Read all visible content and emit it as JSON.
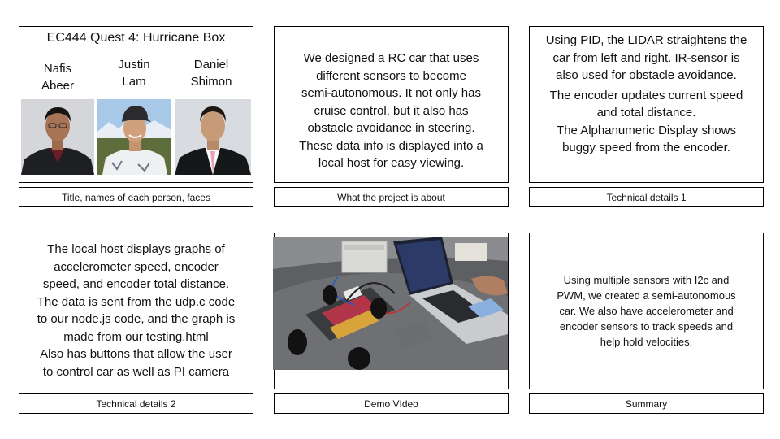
{
  "slide": {
    "title_panel": {
      "title": "EC444 Quest 4: Hurricane Box",
      "people": [
        {
          "first": "Nafis",
          "last": "Abeer"
        },
        {
          "first": "Justin",
          "last": "Lam"
        },
        {
          "first": "Daniel",
          "last": "Shimon"
        }
      ],
      "label": "Title, names of each person, faces"
    },
    "about_panel": {
      "lines": [
        "We designed  a RC car that uses",
        "different sensors to become",
        "semi-autonomous. It not only has",
        "cruise control, but it also has",
        "obstacle avoidance in steering.",
        "These data info is displayed into a",
        "local host for easy viewing."
      ],
      "label": "What the project is about"
    },
    "tech1_panel": {
      "lines": [
        "Using PID, the LIDAR straightens the",
        "car from left and right.  IR-sensor is",
        "also used for obstacle avoidance.",
        "The encoder updates current speed",
        "and total distance.",
        "The Alphanumeric  Display shows",
        "buggy speed from the encoder."
      ],
      "label": "Technical details 1"
    },
    "tech2_panel": {
      "lines": [
        "The local host displays graphs of",
        "accelerometer speed, encoder",
        "speed, and encoder total distance.",
        "The data is sent from the udp.c code",
        "to our node.js code, and the graph is",
        "made from our testing.html",
        "Also has buttons that allow the user",
        "to control car as well as PI camera"
      ],
      "label": "Technical details 2"
    },
    "demo_panel": {
      "label": "Demo VIdeo"
    },
    "summary_panel": {
      "lines": [
        "Using multiple sensors with I2c and",
        "PWM, we created a semi-autonomous",
        "car. We also have accelerometer and",
        "encoder sensors to track speeds and",
        "help hold velocities."
      ],
      "label": "Summary"
    }
  }
}
